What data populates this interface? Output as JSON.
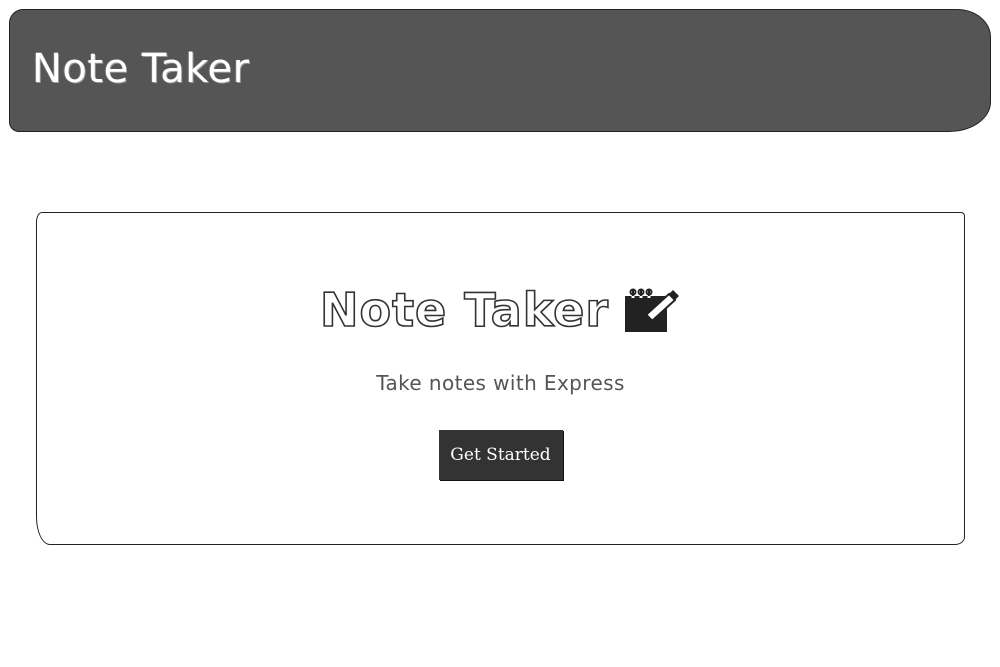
{
  "navbar": {
    "title": "Note Taker"
  },
  "hero": {
    "title": "Note Taker",
    "icon": "note-edit-icon",
    "tagline": "Take notes with Express",
    "button_label": "Get Started"
  },
  "colors": {
    "navbar_bg": "#555555",
    "button_bg": "#333333",
    "text_dark": "#333333"
  }
}
